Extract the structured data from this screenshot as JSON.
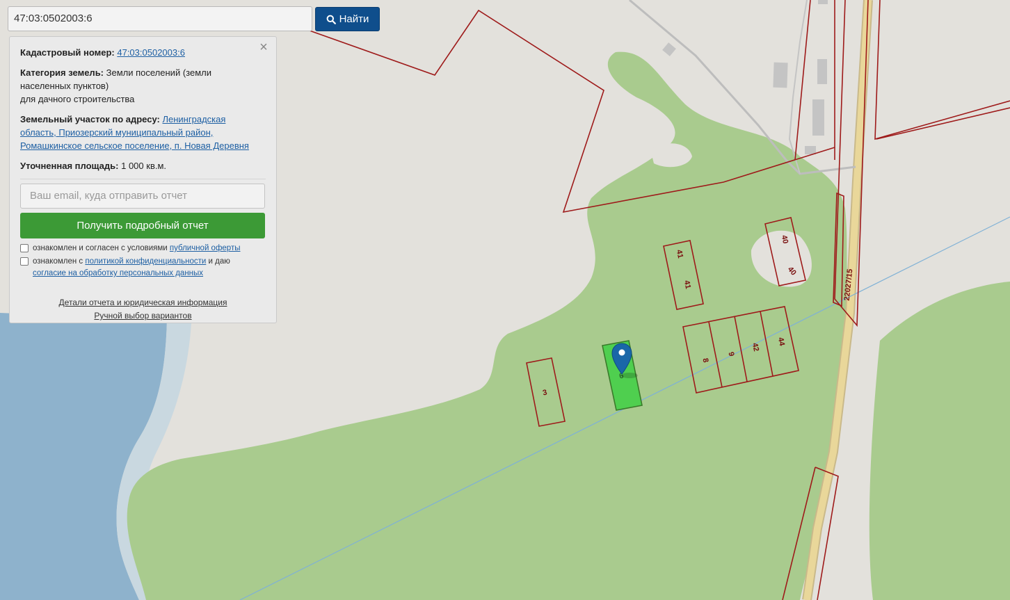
{
  "search": {
    "value": "47:03:0502003:6",
    "button_label": "Найти"
  },
  "panel": {
    "close_label": "×",
    "cadastral": {
      "label": "Кадастровый номер:",
      "value": "47:03:0502003:6"
    },
    "category": {
      "label": "Категория земель:",
      "value_line1": "Земли поселений (земли",
      "value_line2": "населенных пунктов)",
      "value_line3": "для дачного строительства"
    },
    "address": {
      "label": "Земельный участок по адресу:",
      "line1": "Ленинградская",
      "line2": "область, Приозерский муниципальный район,",
      "line3": "Ромашкинское сельское поселение, п. Новая Деревня"
    },
    "area": {
      "label": "Уточненная площадь:",
      "value": "1 000 кв.м."
    },
    "email_placeholder": "Ваш email, куда отправить отчет",
    "report_button": "Получить подробный отчет",
    "consent1": {
      "text": "ознакомлен и согласен с условиями",
      "link": "публичной оферты"
    },
    "consent2": {
      "text_before": "ознакомлен с",
      "link1": "политикой конфиденциальности",
      "text_mid": "и даю",
      "link2": "согласие на обработку персональных данных"
    },
    "footer_link1": "Детали отчета и юридическая информация",
    "footer_link2": "Ручной выбор вариантов"
  },
  "map": {
    "colors": {
      "water": "#8eb2cc",
      "land": "#e3e1dc",
      "forest": "#a9cb8e",
      "parcel_border": "#9e1a1a",
      "selected_fill": "#4fcf4f",
      "marker": "#1a67a8",
      "road": "#e9d79a"
    },
    "parcels": [
      {
        "id": "p3",
        "labels": [
          "3"
        ]
      },
      {
        "id": "p6",
        "labels": [
          "6"
        ]
      },
      {
        "id": "p41",
        "labels": [
          "41",
          "41"
        ]
      },
      {
        "id": "p40",
        "labels": [
          "40",
          "40"
        ]
      },
      {
        "id": "p8",
        "labels": [
          "8"
        ]
      },
      {
        "id": "p9",
        "labels": [
          "9"
        ]
      },
      {
        "id": "p42",
        "labels": [
          "42"
        ]
      },
      {
        "id": "p44",
        "labels": [
          "44"
        ]
      }
    ],
    "road_label": "22027/15",
    "marker_icon": "map-pin-icon"
  }
}
